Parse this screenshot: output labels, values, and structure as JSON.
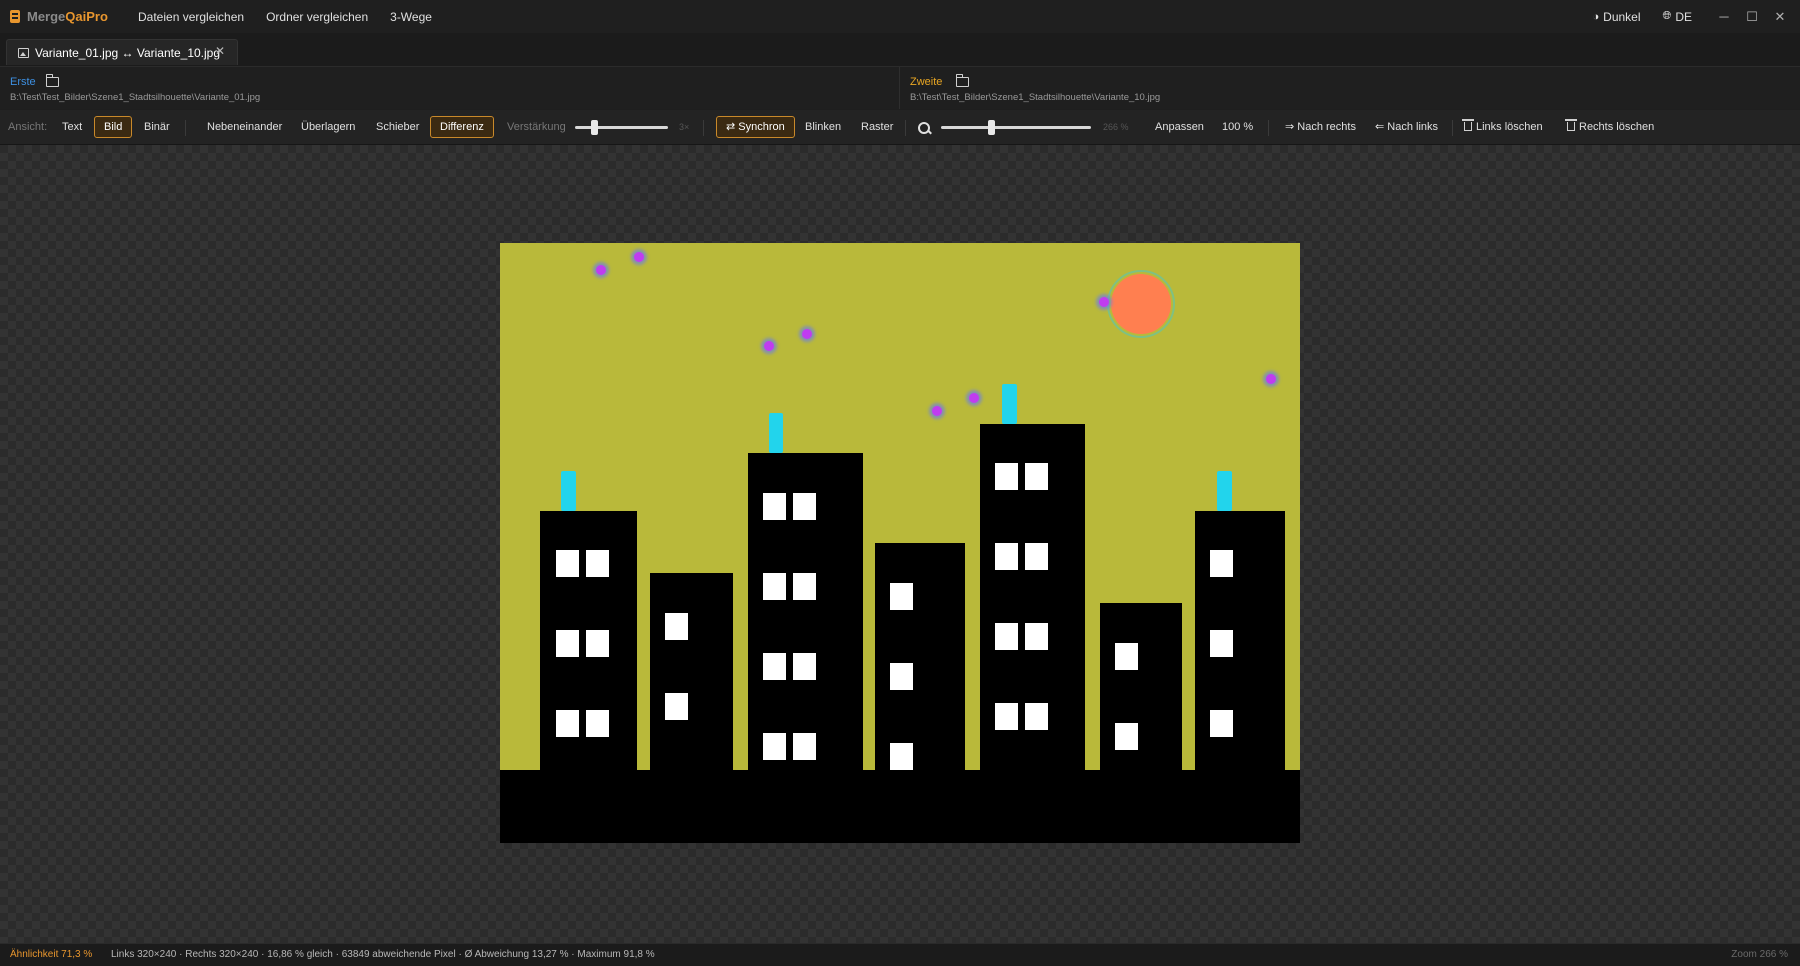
{
  "app": {
    "logo_prefix": "Merge",
    "logo_suffix": "QaiPro",
    "accent_color": "#e8962e"
  },
  "menu": [
    {
      "label": "Dateien vergleichen"
    },
    {
      "label": "Ordner vergleichen"
    },
    {
      "label": "3-Wege"
    }
  ],
  "title_right": {
    "theme_label": "Dunkel",
    "language_label": "DE",
    "theme_icon": "half-circle-icon",
    "language_icon": "globe-icon"
  },
  "window_controls": {
    "minimize": "─",
    "maximize": "☐",
    "close": "✕"
  },
  "tab": {
    "label": "Variante_01.jpg ↔ Variante_10.jpg",
    "close": "✕",
    "icon": "image-icon"
  },
  "left_file": {
    "label": "Erste",
    "path": "B:\\Test\\Test_Bilder\\Szene1_Stadtsilhouette\\Variante_01.jpg",
    "color": "#3d8fe0"
  },
  "right_file": {
    "label": "Zweite",
    "path": "B:\\Test\\Test_Bilder\\Szene1_Stadtsilhouette\\Variante_10.jpg",
    "color": "#e8a623"
  },
  "toolbar": {
    "view_label": "Ansicht:",
    "text_mode": "Text",
    "image_mode": "Bild",
    "binary_mode": "Binär",
    "side_by_side": "Nebeneinander",
    "overlay": "Überlagern",
    "slider_mode": "Schieber",
    "difference": "Differenz",
    "amplification_label": "Verstärkung",
    "amplification_value": "3×",
    "amplification_fraction": 0.2,
    "sync": "⇄ Synchron",
    "blink": "Blinken",
    "grid": "Raster",
    "zoom_value": "266 %",
    "zoom_fraction": 0.33,
    "fit": "Anpassen",
    "actual_size": "100 %",
    "copy_right": "⇒ Nach rechts",
    "copy_left": "⇐ Nach links",
    "delete_left": "Links löschen",
    "delete_right": "Rechts löschen"
  },
  "status": {
    "similarity": "Ähnlichkeit 71,3 %",
    "info": "Links 320×240 · Rechts 320×240 · 16,86 % gleich · 63849 abweichende Pixel · Ø Abweichung 13,27 % · Maximum 91,8 %",
    "zoom": "Zoom 266 %"
  },
  "scene_colors": {
    "sky": "#b9b93a",
    "building": "#000000",
    "window": "#ffffff",
    "chimney": "#22d4ec",
    "sun": "#ff7f50",
    "star": "#c03cf0"
  }
}
